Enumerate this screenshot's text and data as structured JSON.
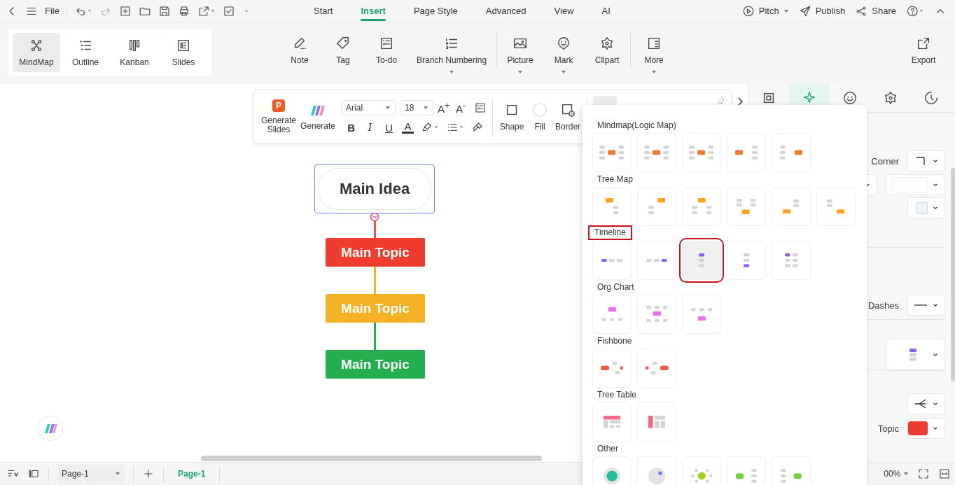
{
  "menu": {
    "file": "File"
  },
  "tabs": [
    {
      "label": "Start",
      "selected": false
    },
    {
      "label": "Insert",
      "selected": true
    },
    {
      "label": "Page Style",
      "selected": false
    },
    {
      "label": "Advanced",
      "selected": false
    },
    {
      "label": "View",
      "selected": false
    },
    {
      "label": "AI",
      "selected": false
    }
  ],
  "top_actions": [
    {
      "label": "Pitch",
      "kind": "pitch",
      "has_menu": true
    },
    {
      "label": "Publish",
      "kind": "publish",
      "has_menu": false
    },
    {
      "label": "Share",
      "kind": "share",
      "has_menu": false
    }
  ],
  "views": [
    {
      "label": "MindMap",
      "kind": "mindmap",
      "selected": true
    },
    {
      "label": "Outline",
      "kind": "outline",
      "selected": false
    },
    {
      "label": "Kanban",
      "kind": "kanban",
      "selected": false
    },
    {
      "label": "Slides",
      "kind": "slides",
      "selected": false
    }
  ],
  "ribbon_groups": [
    [
      {
        "label": "Note",
        "kind": "note",
        "has_menu": false
      },
      {
        "label": "Tag",
        "kind": "tag",
        "has_menu": false
      },
      {
        "label": "To-do",
        "kind": "todo",
        "has_menu": false
      },
      {
        "label": "Branch Numbering",
        "kind": "numbering",
        "has_menu": true
      }
    ],
    [
      {
        "label": "Picture",
        "kind": "picture",
        "has_menu": true
      },
      {
        "label": "Mark",
        "kind": "mark",
        "has_menu": true
      },
      {
        "label": "Clipart",
        "kind": "clipart",
        "has_menu": false
      }
    ],
    [
      {
        "label": "More",
        "kind": "more",
        "has_menu": true
      }
    ]
  ],
  "export": {
    "label": "Export"
  },
  "format_toolbar": {
    "slides_badge": "P",
    "generate_slides": "Generate Slides",
    "generate": "Generate",
    "font": "Arial",
    "size": "18",
    "grow": "A$^{+}$",
    "shrink": "A$^{-}$",
    "text_styles": [
      "B",
      "I",
      "U",
      "A"
    ],
    "shape": "Shape",
    "fill": "Fill",
    "border": "Border"
  },
  "canvas": {
    "main_idea": {
      "text": "Main Idea",
      "selected": true
    },
    "topics": [
      {
        "text": "Main Topic",
        "color": "#f03c2e"
      },
      {
        "text": "Main Topic",
        "color": "#f5b224"
      },
      {
        "text": "Main Topic",
        "color": "#25ae4e"
      }
    ]
  },
  "layout_panel": {
    "sections": [
      {
        "title": "Mindmap(Logic Map)",
        "kind": "mindmap",
        "highlighted": false,
        "tiles": [
          {
            "selected": false
          },
          {
            "selected": false
          },
          {
            "selected": false
          },
          {
            "selected": false
          },
          {
            "selected": false
          }
        ]
      },
      {
        "title": "Tree Map",
        "kind": "tree",
        "highlighted": false,
        "tiles": [
          {
            "selected": false
          },
          {
            "selected": false
          },
          {
            "selected": false
          },
          {
            "selected": false
          },
          {
            "selected": false
          },
          {
            "selected": false
          }
        ]
      },
      {
        "title": "Timeline",
        "kind": "timeline",
        "highlighted": true,
        "tiles": [
          {
            "selected": false
          },
          {
            "selected": false
          },
          {
            "selected": true
          },
          {
            "selected": false
          },
          {
            "selected": false
          }
        ]
      },
      {
        "title": "Org Chart",
        "kind": "org",
        "highlighted": false,
        "tiles": [
          {
            "selected": false
          },
          {
            "selected": false
          },
          {
            "selected": false
          }
        ]
      },
      {
        "title": "Fishbone",
        "kind": "fishbone",
        "highlighted": false,
        "tiles": [
          {
            "selected": false
          },
          {
            "selected": false
          }
        ]
      },
      {
        "title": "Tree Table",
        "kind": "table",
        "highlighted": false,
        "tiles": [
          {
            "selected": false
          },
          {
            "selected": false
          }
        ]
      },
      {
        "title": "Other",
        "kind": "other",
        "highlighted": false,
        "tiles": [
          {
            "selected": false
          },
          {
            "selected": false
          },
          {
            "selected": false
          },
          {
            "selected": false
          },
          {
            "selected": false
          }
        ]
      }
    ]
  },
  "properties": {
    "tabs": [
      {
        "kind": "square",
        "selected": false
      },
      {
        "kind": "sparkle",
        "selected": true
      },
      {
        "kind": "smiley",
        "selected": false
      },
      {
        "kind": "flower",
        "selected": false
      },
      {
        "kind": "clock",
        "selected": false
      }
    ],
    "corner_label": "Corner",
    "dashes_label": "Dashes",
    "topic_label": "Topic"
  },
  "status_bar": {
    "page_select": "Page-1",
    "page_tab": "Page-1",
    "zoom": "00%"
  }
}
